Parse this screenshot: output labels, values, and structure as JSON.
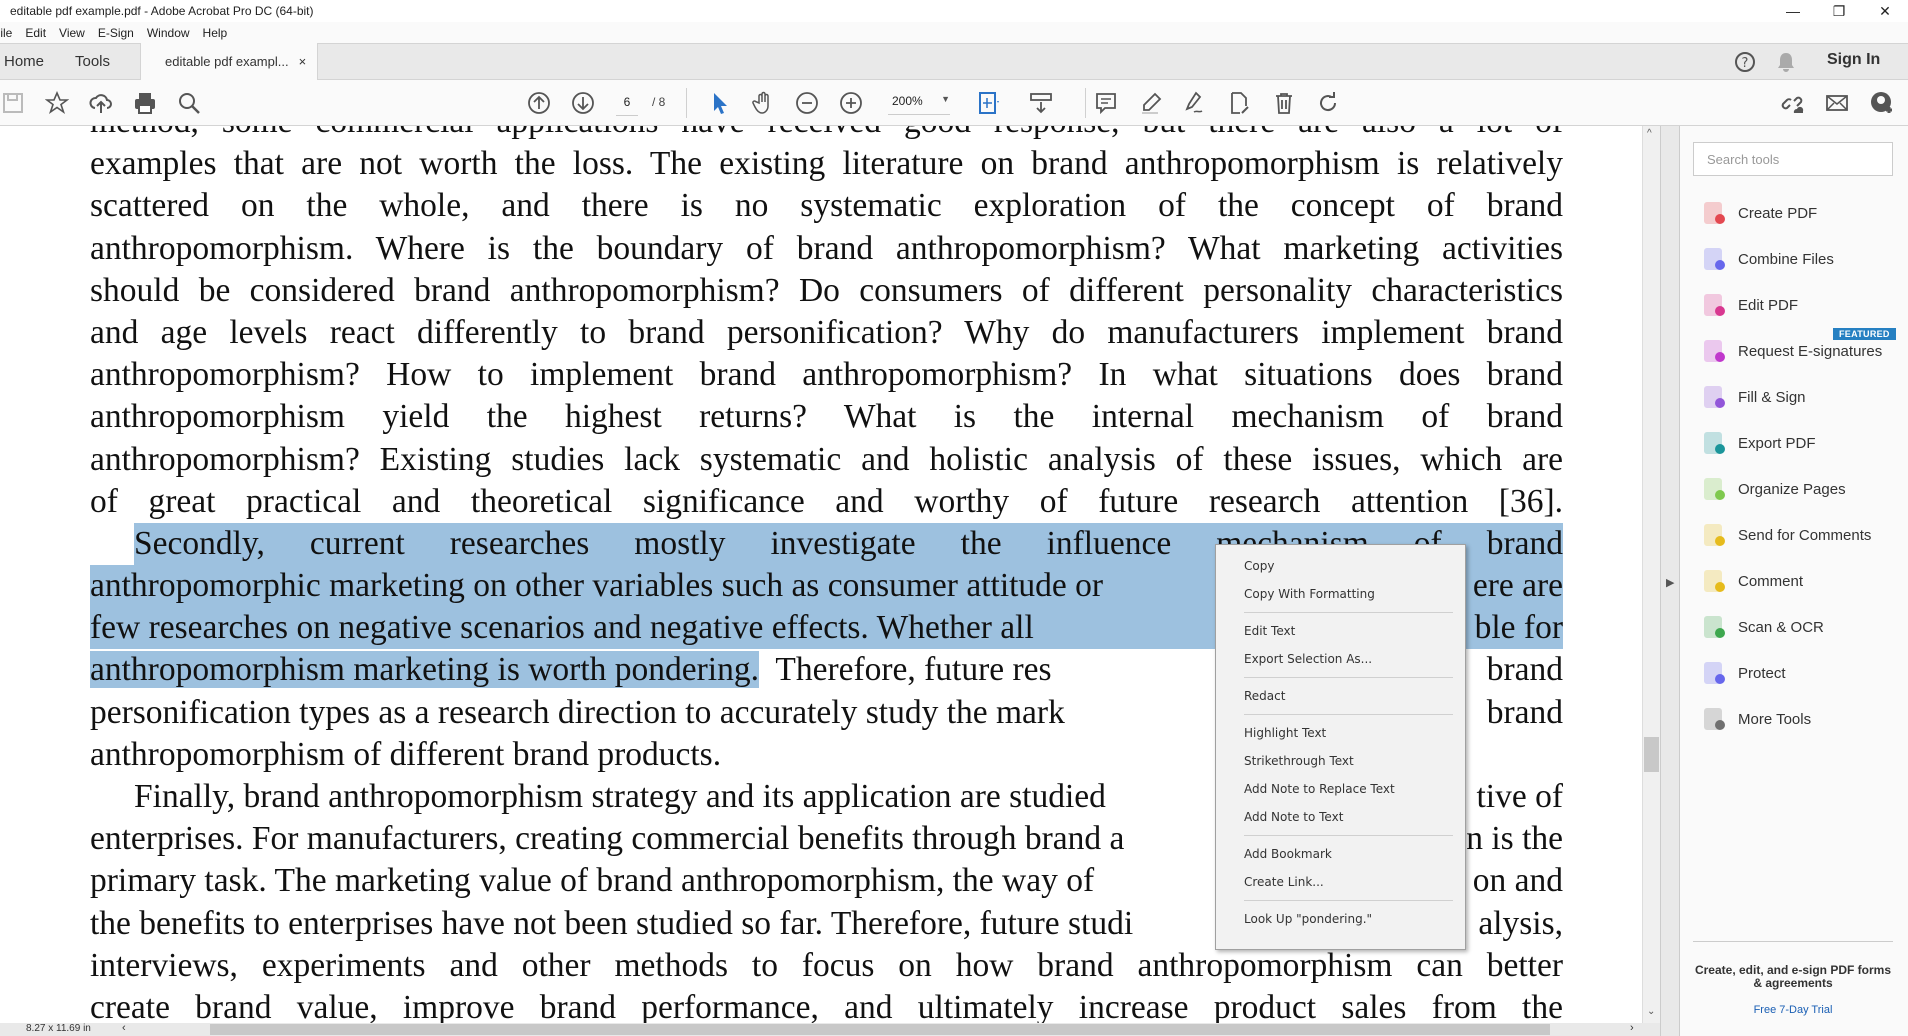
{
  "window": {
    "title": "editable pdf example.pdf - Adobe Acrobat Pro DC (64-bit)"
  },
  "menubar": [
    "File",
    "Edit",
    "View",
    "E-Sign",
    "Window",
    "Help"
  ],
  "tabs": {
    "home": "Home",
    "tools": "Tools",
    "document": "editable pdf exampl...",
    "close": "×",
    "sign_in": "Sign In"
  },
  "toolbar": {
    "page_current": "6",
    "page_total": "/ 8",
    "zoom": "200%"
  },
  "document": {
    "lines": [
      "method, some commercial applications have received good response, but there are also a lot of",
      "examples that are not worth the loss. The existing literature on brand anthropomorphism is relatively",
      "scattered on the whole, and there is no systematic exploration of the concept of brand",
      "anthropomorphism. Where is the boundary of brand anthropomorphism? What marketing activities",
      "should be considered brand anthropomorphism? Do consumers of different personality characteristics",
      "and age levels react differently to brand personification? Why do manufacturers implement brand",
      "anthropomorphism? How to implement brand anthropomorphism? In what situations does brand",
      "anthropomorphism yield the highest returns? What is the internal mechanism of brand",
      "anthropomorphism? Existing studies lack systematic and holistic analysis of these issues, which are",
      "of great practical and theoretical significance and worthy of future research attention [36].",
      "Secondly, current researches mostly investigate the influence mechanism of brand"
    ],
    "split_lines": [
      {
        "left": "anthropomorphic marketing on other variables such as consumer attitude or",
        "right": "ere are"
      },
      {
        "left": "few researches on negative scenarios and negative effects. Whether all",
        "right": "ble for"
      },
      {
        "selected": "anthropomorphism marketing is worth pondering.",
        "left": "Therefore, future res",
        "right": "brand"
      },
      {
        "left": "personification types as a research direction to accurately study the mark",
        "right": "brand"
      }
    ],
    "line_after": "anthropomorphism of different brand products.",
    "split_lines2": [
      {
        "left": "Finally, brand anthropomorphism strategy and its application are studied",
        "right": "tive of"
      },
      {
        "left": "enterprises. For manufacturers, creating commercial benefits through brand a",
        "right": "n is the"
      },
      {
        "left": "primary task. The marketing value of brand anthropomorphism, the way of",
        "right": "on and"
      },
      {
        "left": "the benefits to enterprises have not been studied so far. Therefore, future studi",
        "right": "alysis,"
      }
    ],
    "lines_end": [
      "interviews, experiments and other methods to focus on how brand anthropomorphism can better",
      "create brand value, improve brand performance, and ultimately increase product sales from the"
    ],
    "selection_color": "#9dc1df"
  },
  "context_menu": [
    "Copy",
    "Copy With Formatting",
    "Edit Text",
    "Export Selection As...",
    "Redact",
    "Highlight Text",
    "Strikethrough Text",
    "Add Note to Replace Text",
    "Add Note to Text",
    "Add Bookmark",
    "Create Link...",
    "Look Up \"pondering.\""
  ],
  "right_panel": {
    "search_placeholder": "Search tools",
    "featured": "FEATURED",
    "tools": [
      {
        "label": "Create PDF",
        "color": "#e34850"
      },
      {
        "label": "Combine Files",
        "color": "#6767ec"
      },
      {
        "label": "Edit PDF",
        "color": "#d83790"
      },
      {
        "label": "Request E-signatures",
        "color": "#c038cc"
      },
      {
        "label": "Fill & Sign",
        "color": "#9256d9"
      },
      {
        "label": "Export PDF",
        "color": "#1b959a"
      },
      {
        "label": "Organize Pages",
        "color": "#7fc94e"
      },
      {
        "label": "Send for Comments",
        "color": "#e6bb1c"
      },
      {
        "label": "Comment",
        "color": "#e6bb1c"
      },
      {
        "label": "Scan & OCR",
        "color": "#3da74e"
      },
      {
        "label": "Protect",
        "color": "#6767ec"
      },
      {
        "label": "More Tools",
        "color": "#707070"
      }
    ],
    "promo": "Create, edit, and e-sign PDF forms & agreements",
    "trial": "Free 7-Day Trial"
  },
  "status": {
    "page_size": "8.27 x 11.69 in"
  }
}
